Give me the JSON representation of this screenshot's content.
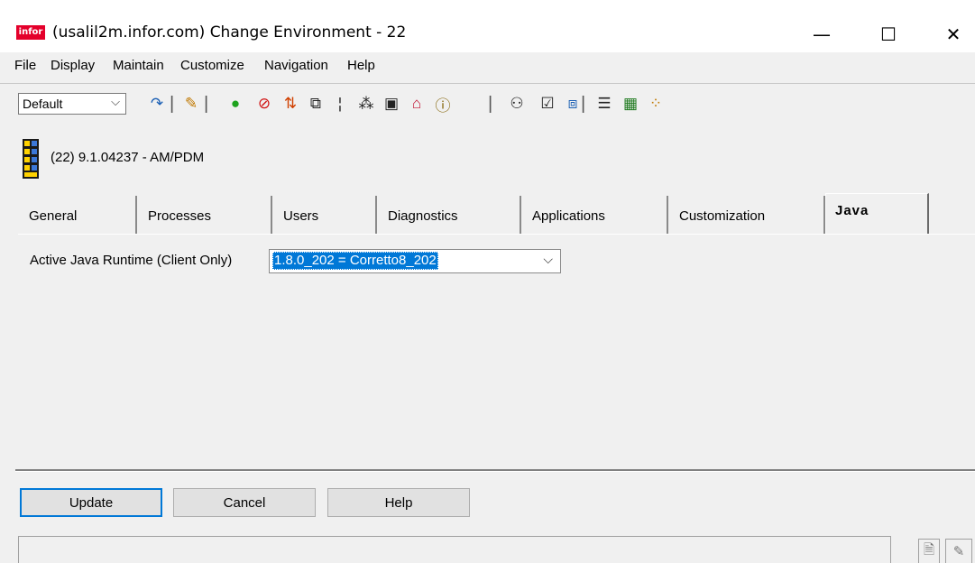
{
  "window": {
    "logo_text": "infor",
    "title": "(usalil2m.infor.com) Change Environment - 22",
    "minimize": "—",
    "maximize": "☐",
    "close": "✕"
  },
  "menu": [
    {
      "label": "File"
    },
    {
      "label": "Display"
    },
    {
      "label": "Maintain"
    },
    {
      "label": "Customize"
    },
    {
      "label": "Navigation"
    },
    {
      "label": "Help"
    }
  ],
  "toolbar": {
    "combo_value": "Default",
    "combo_arrow": "⌵",
    "icons": [
      {
        "name": "refresh-icon",
        "glyph": "↷",
        "color": "#1a5fb4"
      },
      {
        "name": "edit-pencil-icon",
        "glyph": "✎",
        "color": "#c07800"
      },
      {
        "name": "start-green-icon",
        "glyph": "●",
        "color": "#1fa31f"
      },
      {
        "name": "stop-red-icon",
        "glyph": "⊘",
        "color": "#d01010"
      },
      {
        "name": "transfer-arrows-icon",
        "glyph": "⇅",
        "color": "#d04000"
      },
      {
        "name": "copy-icon",
        "glyph": "⧉",
        "color": "#222222"
      },
      {
        "name": "text-cursor-icon",
        "glyph": "¦",
        "color": "#222222"
      },
      {
        "name": "cell-refs-icon",
        "glyph": "⁂",
        "color": "#222222"
      },
      {
        "name": "database-icon",
        "glyph": "▣",
        "color": "#222222"
      },
      {
        "name": "home-red-icon",
        "glyph": "⌂",
        "color": "#c01030"
      },
      {
        "name": "info-note-icon",
        "glyph": "ⓘ",
        "color": "#806000"
      },
      {
        "name": "tree-users-icon",
        "glyph": "⚇",
        "color": "#222222"
      },
      {
        "name": "checklist-icon",
        "glyph": "☑",
        "color": "#222222"
      },
      {
        "name": "windows-icon",
        "glyph": "⧈",
        "color": "#1a5fb4"
      },
      {
        "name": "list-icon",
        "glyph": "☰",
        "color": "#222222"
      },
      {
        "name": "chart-icon",
        "glyph": "▦",
        "color": "#1f7a1f"
      },
      {
        "name": "dots-grid-icon",
        "glyph": "⁘",
        "color": "#c07800"
      }
    ]
  },
  "environment": {
    "label": "(22)  9.1.04237 - AM/PDM"
  },
  "tabs": [
    {
      "label": "General"
    },
    {
      "label": "Processes"
    },
    {
      "label": "Users"
    },
    {
      "label": "Diagnostics"
    },
    {
      "label": "Applications"
    },
    {
      "label": "Customization"
    },
    {
      "label": "Java"
    }
  ],
  "java": {
    "runtime_label": "Active Java Runtime (Client Only)",
    "runtime_value": "1.8.0_202 = Corretto8_202",
    "dropdown_arrow": "⌵"
  },
  "buttons": {
    "update": "Update",
    "cancel": "Cancel",
    "help": "Help"
  },
  "status": {
    "text": "",
    "icon1": "🗎",
    "icon2": "✎"
  }
}
